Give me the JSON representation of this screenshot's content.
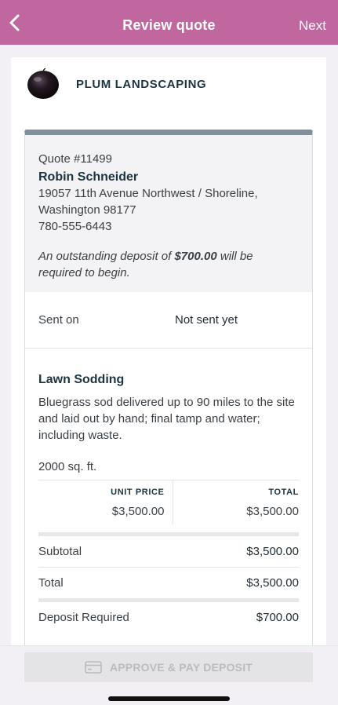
{
  "nav": {
    "title": "Review quote",
    "next_label": "Next"
  },
  "company": {
    "name": "PLUM LANDSCAPING"
  },
  "quote": {
    "number": "Quote #11499",
    "client_name": "Robin Schneider",
    "address_line1": "19057 11th Avenue Northwest / Shoreline,",
    "address_line2": "Washington 98177",
    "phone": "780-555-6443",
    "deposit_note_prefix": "An outstanding deposit of ",
    "deposit_amount": "$700.00",
    "deposit_note_suffix": " will be required to begin."
  },
  "sent": {
    "label": "Sent on",
    "value": "Not sent yet"
  },
  "line_item": {
    "name": "Lawn Sodding",
    "description": "Bluegrass sod delivered up to 90 miles to the site and laid out by hand; final tamp and water; including waste.",
    "quantity": "2000 sq. ft.",
    "unit_price_header": "UNIT PRICE",
    "unit_price": "$3,500.00",
    "total_header": "TOTAL",
    "total": "$3,500.00"
  },
  "summary": {
    "subtotal_label": "Subtotal",
    "subtotal": "$3,500.00",
    "total_label": "Total",
    "total": "$3,500.00",
    "deposit_label": "Deposit Required",
    "deposit": "$700.00"
  },
  "footer": {
    "approve_label": "APPROVE & PAY DEPOSIT"
  },
  "colors": {
    "nav_bg": "#c0679f",
    "card_top_border": "#7f8f9c",
    "disabled_button": "#e4e4e6"
  }
}
